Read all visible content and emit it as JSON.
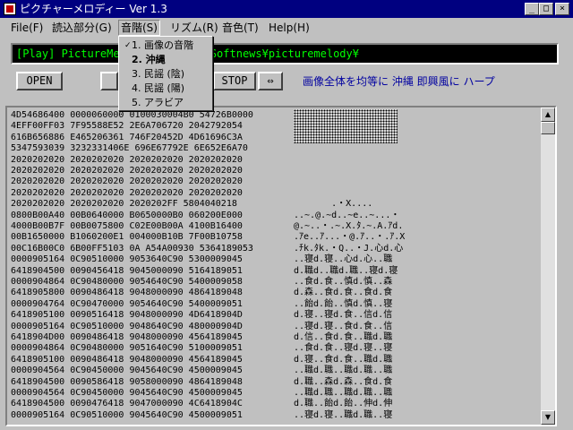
{
  "window": {
    "title": "ピクチャーメロディー  Ver 1.3",
    "minimize": "_",
    "maximize": "□",
    "close": "×"
  },
  "menu": [
    {
      "label": "File(F)"
    },
    {
      "label": "読込部分(G)"
    },
    {
      "label": "音階(S)"
    },
    {
      "label": "リズム(R)"
    },
    {
      "label": "音色(T)"
    },
    {
      "label": "Help(H)"
    }
  ],
  "path": "[Play] PictureMelody  C:¥Softnews¥picturemelody¥",
  "path_visible_prefix": "[Play] PictureMe",
  "path_visible_suffix": "¥Softnews¥picturemelody¥",
  "buttons": {
    "open": "OPEN",
    "stop": "STOP",
    "swap": "⇔"
  },
  "description": "画像全体を均等に 沖縄 即興風に ハープ",
  "dropdown": {
    "check": "✓",
    "items": [
      {
        "label": "1. 画像の音階",
        "checked": true
      },
      {
        "label": "2. 沖縄",
        "bold": true
      },
      {
        "label": "3. 民謡 (陰)"
      },
      {
        "label": "4. 民謡 (陽)"
      },
      {
        "label": "5. アラビア"
      }
    ]
  },
  "hex_rows": [
    {
      "hex": "4D54686400 0000060000 0100030004B0 54726B0000",
      "ascii": ""
    },
    {
      "hex": "4EFF00FF03 7F95588E52 2E6A706720 2042792054",
      "ascii": ""
    },
    {
      "hex": "616B656886 E465206361 746F20452D 4D61696C3A",
      "ascii": ""
    },
    {
      "hex": "5347593039 3232331406E 696E67792E 6E652E6A70",
      "ascii": ""
    },
    {
      "hex": "2020202020 2020202020 2020202020 2020202020",
      "ascii": ""
    },
    {
      "hex": "2020202020 2020202020 2020202020 2020202020",
      "ascii": ""
    },
    {
      "hex": "2020202020 2020202020 2020202020 2020202020",
      "ascii": ""
    },
    {
      "hex": "2020202020 2020202020 2020202020 2020202020",
      "ascii": ""
    },
    {
      "hex": "2020202020 2020202020 2020202FF 5804040218",
      "ascii": "       .・X...."
    },
    {
      "hex": "0800B00A40 00B0640000 B0650000B0 060200E000",
      "ascii": "..~.@.~d..~e..~...・"
    },
    {
      "hex": "4000B00B7F 00B0075800 C02E00B00A 4100B16400",
      "ascii": "@.~..・.~.X.ﾀ.~.A.ｱd."
    },
    {
      "hex": "00B1650000 B1060200E1 004000B10B 7F00B10758",
      "ascii": ".ｱe..ｱ...・@.ｱ..・.ｱ.X"
    },
    {
      "hex": "00C16B00C0 6B00FF5103 0A A54A00930 5364189053",
      "ascii": ".ﾁk.ﾀk.・Q..・J.心d.心"
    },
    {
      "hex": "0000905164 0C90510000 9053640C90 5300009045",
      "ascii": "..寝d.寝..心d.心..職"
    },
    {
      "hex": "6418904500 0090456418 9045000090 5164189051",
      "ascii": "d.職d..職d.職..寝d.寝"
    },
    {
      "hex": "0000904864 0C90480000 9054640C90 5400009058",
      "ascii": "..食d.食..慎d.慎..森"
    },
    {
      "hex": "6418905800 0090486418 9048000090 4864189048",
      "ascii": "d.森..食d.食..食d.食"
    },
    {
      "hex": "0000904764 0C90470000 9054640C90 5400009051",
      "ascii": "..飴d.飴..慎d.慎..寝"
    },
    {
      "hex": "6418905100 0090516418 9048000090 4D6418904D",
      "ascii": "d.寝..寝d.食..信d.信"
    },
    {
      "hex": "0000905164 0C90510000 9048640C90 480000904D",
      "ascii": "..寝d.寝..食d.食..信"
    },
    {
      "hex": "6418904D00 0090486418 9048000090 4564189045",
      "ascii": "d.信..食d.食..職d.職"
    },
    {
      "hex": "0000904864 0C90480000 9051640C90 5100009051",
      "ascii": "..食d.食..寝d.寝..寝"
    },
    {
      "hex": "6418905100 0090486418 9048000090 4564189045",
      "ascii": "d.寝..食d.食..職d.職"
    },
    {
      "hex": "0000904564 0C90450000 9045640C90 4500009045",
      "ascii": "..職d.職..職d.職..職"
    },
    {
      "hex": "6418904500 0090586418 9058000090 4864189048",
      "ascii": "d.職..森d.森..食d.食"
    },
    {
      "hex": "0000904564 0C90450000 9045640C90 4500009045",
      "ascii": "..職d.職..職d.職..職"
    },
    {
      "hex": "6418904500 0090476418 9047000090 4C6418904C",
      "ascii": "d.職..飴d.飴..伸d.伸"
    },
    {
      "hex": "0000905164 0C90510000 9045640C90 4500009051",
      "ascii": "..寝d.寝..職d.職..寝"
    }
  ]
}
